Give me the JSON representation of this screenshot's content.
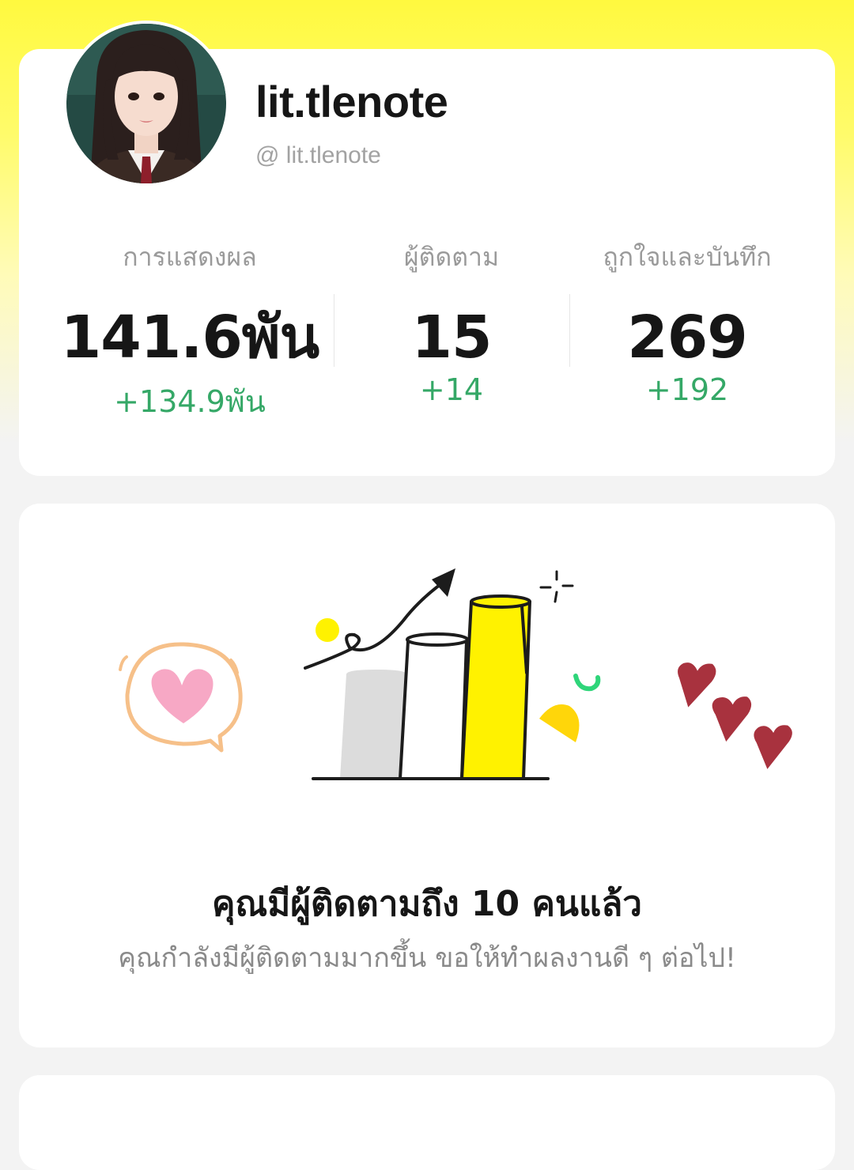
{
  "profile": {
    "username": "lit.tlenote",
    "handle": "@ lit.tlenote"
  },
  "stats": [
    {
      "label": "การแสดงผล",
      "value": "141.6พัน",
      "delta": "+134.9พัน"
    },
    {
      "label": "ผู้ติดตาม",
      "value": "15",
      "delta": "+14"
    },
    {
      "label": "ถูกใจและบันทึก",
      "value": "269",
      "delta": "+192"
    }
  ],
  "milestone": {
    "title": "คุณมีผู้ติดตามถึง 10 คนแล้ว",
    "subtitle": "คุณกำลังมีผู้ติดตามมากขึ้น ขอให้ทำผลงานดี ๆ ต่อไป!"
  },
  "colors": {
    "accent_yellow": "#fff200",
    "delta_green": "#35a867",
    "heart_pink": "#f7a8c5",
    "heart_red": "#a8323e",
    "bubble_orange": "#f6c089",
    "sparkle_green": "#2fd57a"
  }
}
